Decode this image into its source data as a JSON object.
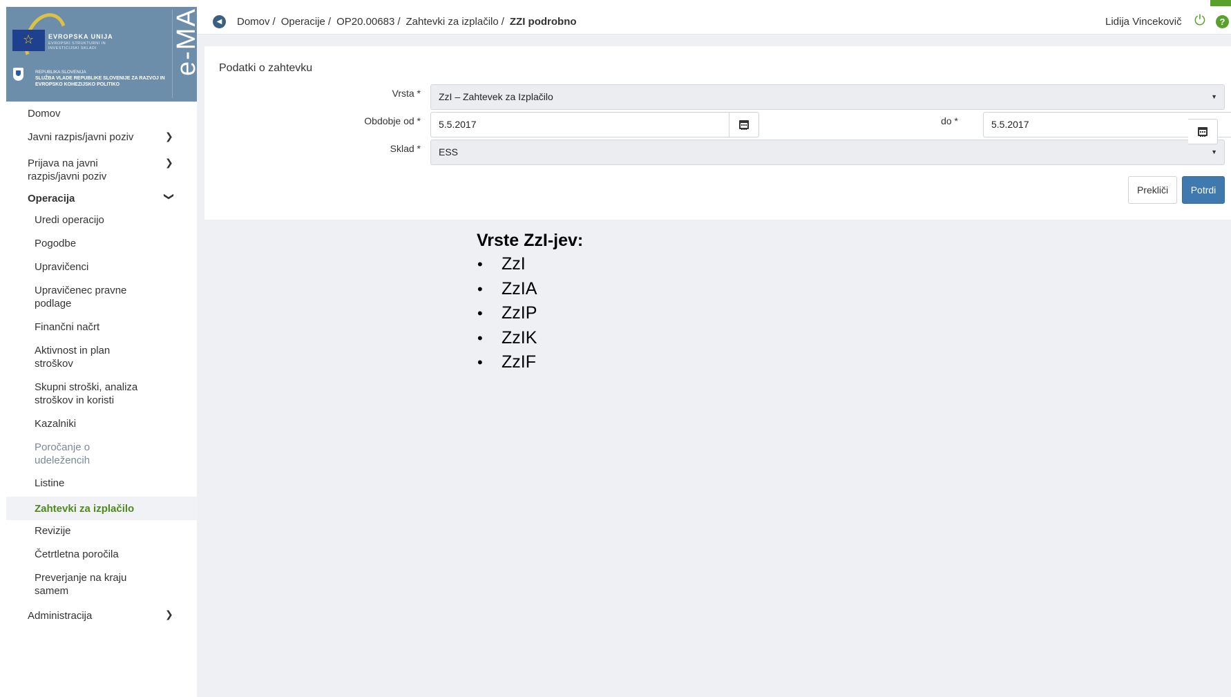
{
  "logo": {
    "eu_title": "EVROPSKA UNIJA",
    "eu_subtitle": "EVROPSKI STRUKTURNI IN INVESTICIJSKI SKLADI",
    "rs_line1": "REPUBLIKA SLOVENIJA",
    "rs_line2": "SLUŽBA VLADE REPUBLIKE SLOVENIJE ZA RAZVOJ IN EVROPSKO KOHEZIJSKO POLITIKO",
    "app_name": "e-MA"
  },
  "sidebar": {
    "items": [
      {
        "label": "Domov"
      },
      {
        "label": "Javni razpis/javni poziv"
      },
      {
        "label": "Prijava na javni razpis/javni poziv"
      },
      {
        "label": "Operacija"
      },
      {
        "label": "Uredi operacijo"
      },
      {
        "label": "Pogodbe"
      },
      {
        "label": "Upravičenci"
      },
      {
        "label": "Upravičenec pravne podlage"
      },
      {
        "label": "Finančni načrt"
      },
      {
        "label": "Aktivnost in plan stroškov"
      },
      {
        "label": "Skupni stroški, analiza stroškov in koristi"
      },
      {
        "label": "Kazalniki"
      },
      {
        "label": "Poročanje o udeležencih"
      },
      {
        "label": "Listine"
      },
      {
        "label": "Zahtevki za izplačilo"
      },
      {
        "label": "Revizije"
      },
      {
        "label": "Četrtletna poročila"
      },
      {
        "label": "Preverjanje na kraju samem"
      },
      {
        "label": "Administracija"
      }
    ]
  },
  "topbar": {
    "breadcrumb": [
      "Domov",
      "Operacije",
      "OP20.00683",
      "Zahtevki za izplačilo",
      "ZZI podrobno"
    ],
    "separator": "/",
    "user_name": "Lidija Vincekovič"
  },
  "form": {
    "title": "Podatki o zahtevku",
    "vrsta_label": "Vrsta *",
    "vrsta_value": "ZzI – Zahtevek za Izplačilo",
    "obdobje_od_label": "Obdobje od *",
    "obdobje_od_value": "5.5.2017",
    "do_label": "do *",
    "do_value": "5.5.2017",
    "sklad_label": "Sklad *",
    "sklad_value": "ESS",
    "cancel_label": "Prekliči",
    "confirm_label": "Potrdi"
  },
  "types": {
    "title": "Vrste ZzI-jev:",
    "items": [
      "ZzI",
      "ZzIA",
      "ZzIP",
      "ZzIK",
      "ZzIF"
    ]
  },
  "colors": {
    "accent_green": "#5aa02c",
    "primary_blue": "#3f79ad",
    "logo_bg": "#6c8eab"
  }
}
